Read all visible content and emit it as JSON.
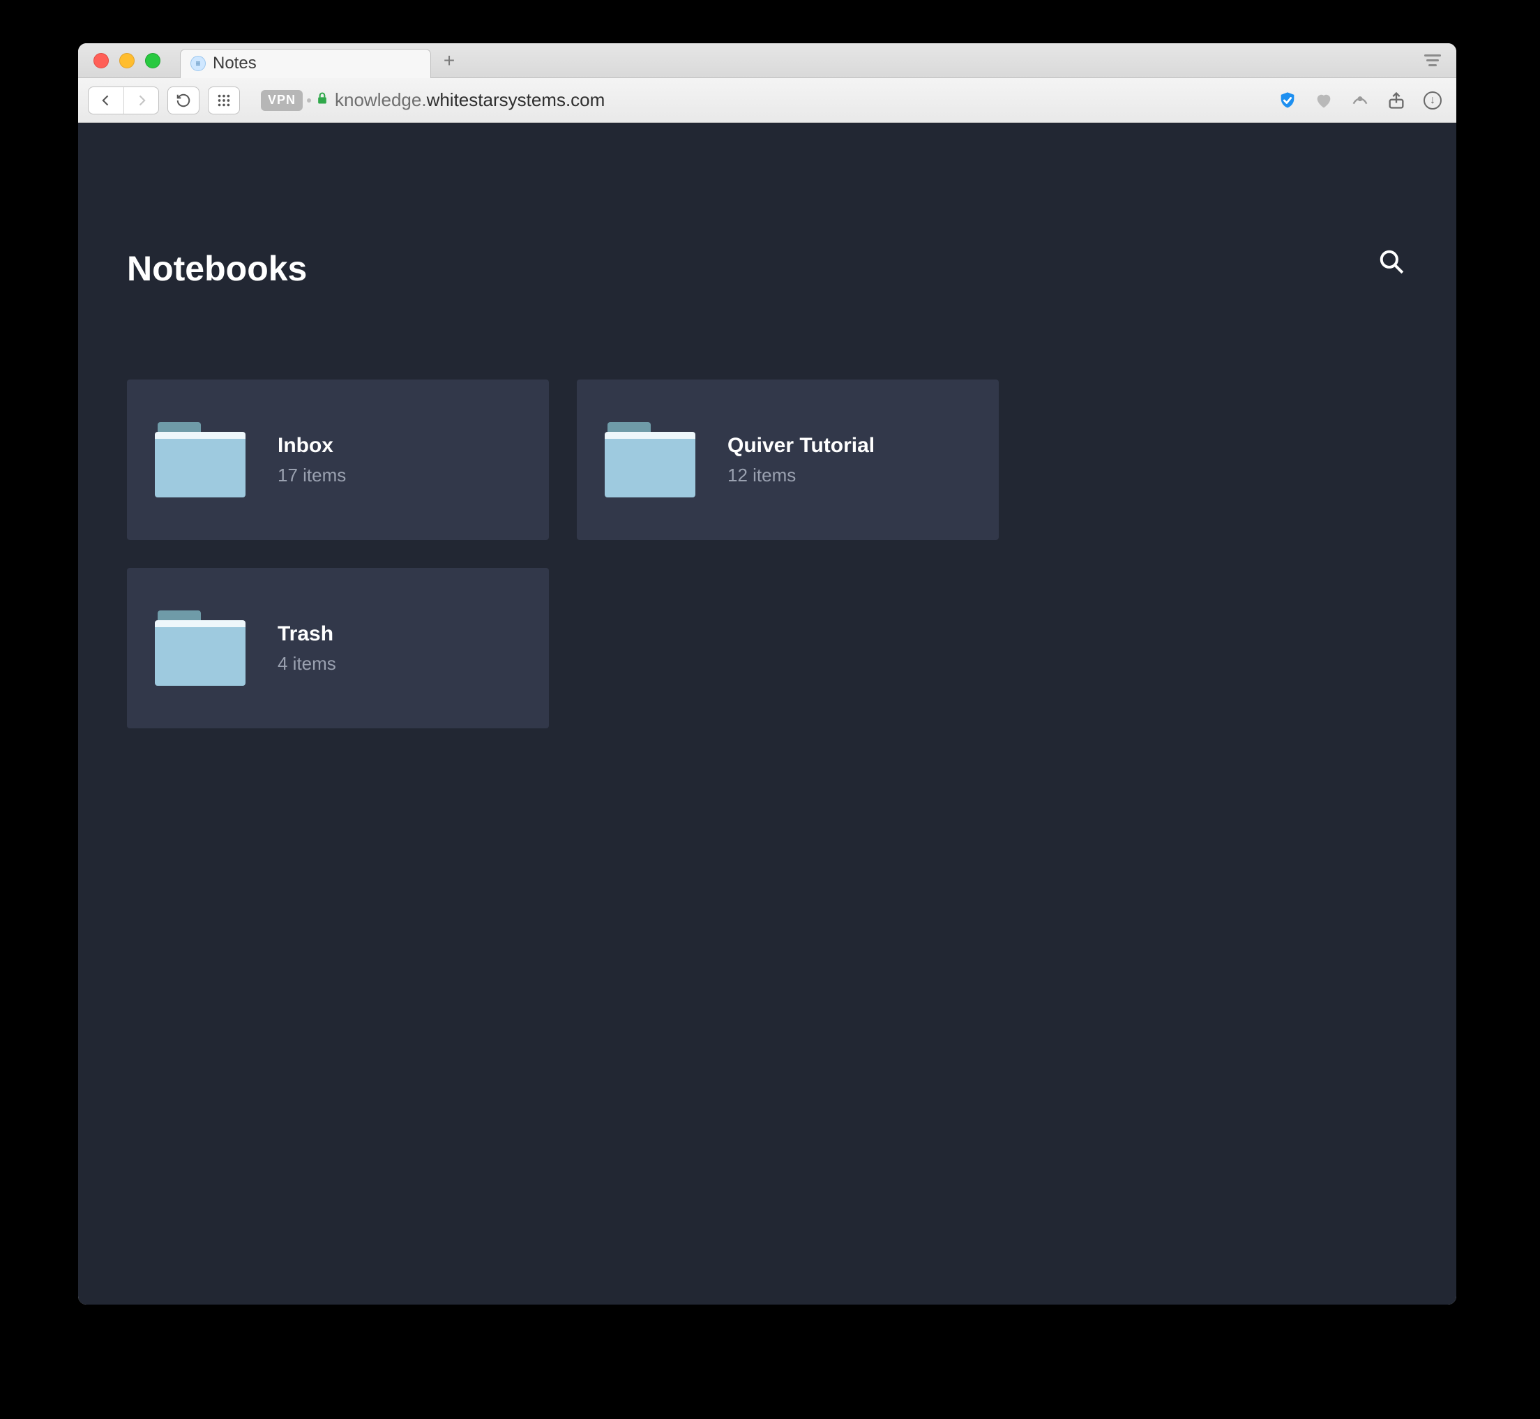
{
  "browser": {
    "tab_title": "Notes",
    "vpn_label": "VPN",
    "url_prefix": "knowledge.",
    "url_domain": "whitestarsystems.com"
  },
  "page": {
    "title": "Notebooks"
  },
  "notebooks": [
    {
      "name": "Inbox",
      "count_label": "17 items"
    },
    {
      "name": "Quiver Tutorial",
      "count_label": "12 items"
    },
    {
      "name": "Trash",
      "count_label": "4 items"
    }
  ]
}
